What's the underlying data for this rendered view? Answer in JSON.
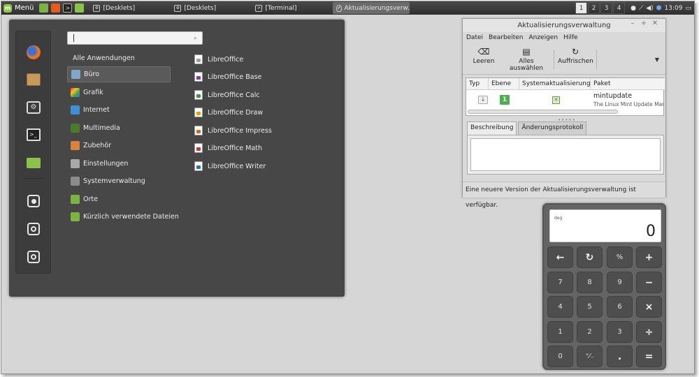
{
  "panel": {
    "menu_label": "Menü",
    "tasks": [
      {
        "label": "[Desklets]"
      },
      {
        "label": "[Desklets]"
      },
      {
        "label": "[Terminal]"
      },
      {
        "label": "Aktualisierungsverw..."
      }
    ],
    "workspaces": [
      "1",
      "2",
      "3",
      "4"
    ],
    "clock": "13:09"
  },
  "app_menu": {
    "search_placeholder": "",
    "all_apps_label": "Alle Anwendungen",
    "categories": [
      {
        "label": "Büro",
        "icon": "office-icon",
        "color": "#7fa7c9"
      },
      {
        "label": "Grafik",
        "icon": "graphics-icon",
        "color": "#e0568c"
      },
      {
        "label": "Internet",
        "icon": "internet-icon",
        "color": "#3f8fd6"
      },
      {
        "label": "Multimedia",
        "icon": "multimedia-icon",
        "color": "#4a7a2a"
      },
      {
        "label": "Zubehör",
        "icon": "accessories-icon",
        "color": "#d9823b"
      },
      {
        "label": "Einstellungen",
        "icon": "settings-icon",
        "color": "#a9a9a9"
      },
      {
        "label": "Systemverwaltung",
        "icon": "system-admin-icon",
        "color": "#8c8c8c"
      },
      {
        "label": "Orte",
        "icon": "places-icon",
        "color": "#7cb342"
      },
      {
        "label": "Kürzlich verwendete Dateien",
        "icon": "recent-files-icon",
        "color": "#7cb342"
      }
    ],
    "apps": [
      {
        "label": "LibreOffice",
        "color": "#9e9e9e"
      },
      {
        "label": "LibreOffice Base",
        "color": "#7b3fa0"
      },
      {
        "label": "LibreOffice Calc",
        "color": "#3a9b3a"
      },
      {
        "label": "LibreOffice Draw",
        "color": "#e5a100"
      },
      {
        "label": "LibreOffice Impress",
        "color": "#d2691e"
      },
      {
        "label": "LibreOffice Math",
        "color": "#c0392b"
      },
      {
        "label": "LibreOffice Writer",
        "color": "#2f6fb3"
      }
    ]
  },
  "update_manager": {
    "title": "Aktualisierungsverwaltung",
    "menus": [
      "Datei",
      "Bearbeiten",
      "Anzeigen",
      "Hilfe"
    ],
    "toolbar": {
      "clear": "Leeren",
      "select_all": "Alles auswählen",
      "refresh": "Auffrischen"
    },
    "columns": [
      "Typ",
      "Ebene",
      "Systemaktualisierung",
      "Paket"
    ],
    "rows": [
      {
        "level": "1",
        "package": "mintupdate",
        "description": "The Linux Mint Update Manag"
      }
    ],
    "tabs": [
      "Beschreibung",
      "Änderungsprotokoll"
    ],
    "status": "Eine neuere Version der Aktualisierungsverwaltung ist verfügbar."
  },
  "calculator": {
    "mode": "deg",
    "display": "0",
    "keys": [
      "←",
      "↻",
      "%",
      "+",
      "7",
      "8",
      "9",
      "−",
      "4",
      "5",
      "6",
      "×",
      "1",
      "2",
      "3",
      "÷",
      "0",
      "⁺⁄₋",
      ".",
      "="
    ]
  }
}
